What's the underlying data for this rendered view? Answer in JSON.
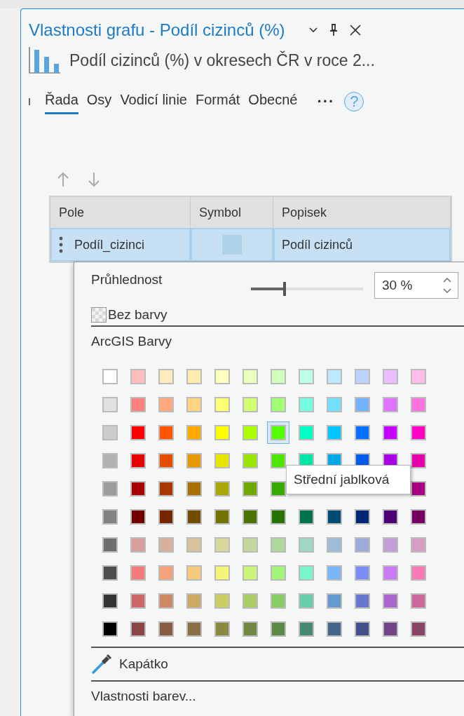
{
  "window": {
    "title": "Vlastnosti grafu - Podíl cizinců (%)"
  },
  "chart_title": "Podíl cizinců (%) v okresech ČR v roce 2...",
  "tabs": [
    {
      "label": "Řada",
      "selected": true
    },
    {
      "label": "Osy",
      "selected": false
    },
    {
      "label": "Vodicí linie",
      "selected": false
    },
    {
      "label": "Formát",
      "selected": false
    },
    {
      "label": "Obecné",
      "selected": false
    }
  ],
  "more": "···",
  "help": "?",
  "table": {
    "columns": [
      "Pole",
      "Symbol",
      "Popisek"
    ],
    "rows": [
      {
        "field": "Podíl_cizinci",
        "label": "Podíl cizinců",
        "selected": true
      }
    ]
  },
  "popup": {
    "transparency_label": "Průhlednost",
    "transparency": {
      "level": 0.3,
      "value": "30 %"
    },
    "no_color": "Bez barvy",
    "palette_title": "ArcGIS Barvy",
    "swatches": [
      [
        {
          "color": "#ffffff",
          "selected": false
        },
        {
          "color": "#ffbebe",
          "selected": false
        },
        {
          "color": "#ffebbe",
          "selected": false
        },
        {
          "color": "#ffebaf",
          "selected": false
        },
        {
          "color": "#ffffbe",
          "selected": false
        },
        {
          "color": "#e9ffbe",
          "selected": false
        },
        {
          "color": "#d3ffbe",
          "selected": false
        },
        {
          "color": "#beffe8",
          "selected": false
        },
        {
          "color": "#bee8ff",
          "selected": false
        },
        {
          "color": "#bed2ff",
          "selected": false
        },
        {
          "color": "#e8beff",
          "selected": false
        },
        {
          "color": "#ffbee8",
          "selected": false
        }
      ],
      [
        {
          "color": "#e1e1e1",
          "selected": false
        },
        {
          "color": "#ff7f7f",
          "selected": false
        },
        {
          "color": "#ffa77f",
          "selected": false
        },
        {
          "color": "#ffd37f",
          "selected": false
        },
        {
          "color": "#ffff73",
          "selected": false
        },
        {
          "color": "#d1ff73",
          "selected": false
        },
        {
          "color": "#a3ff73",
          "selected": false
        },
        {
          "color": "#73ffdf",
          "selected": false
        },
        {
          "color": "#73dfff",
          "selected": false
        },
        {
          "color": "#73b2ff",
          "selected": false
        },
        {
          "color": "#df73ff",
          "selected": false
        },
        {
          "color": "#ff73df",
          "selected": false
        }
      ],
      [
        {
          "color": "#cccccc",
          "selected": false
        },
        {
          "color": "#ff0000",
          "selected": false
        },
        {
          "color": "#ff5500",
          "selected": false
        },
        {
          "color": "#ffaa00",
          "selected": false
        },
        {
          "color": "#ffff00",
          "selected": false
        },
        {
          "color": "#aaff00",
          "selected": false
        },
        {
          "color": "#55ff00",
          "selected": true
        },
        {
          "color": "#00ffc5",
          "selected": false
        },
        {
          "color": "#00c5ff",
          "selected": false
        },
        {
          "color": "#0070ff",
          "selected": false
        },
        {
          "color": "#c500ff",
          "selected": false
        },
        {
          "color": "#ff00c5",
          "selected": false
        }
      ],
      [
        {
          "color": "#b2b2b2",
          "selected": false
        },
        {
          "color": "#e60000",
          "selected": false
        },
        {
          "color": "#e64c00",
          "selected": false
        },
        {
          "color": "#e69800",
          "selected": false
        },
        {
          "color": "#e6e600",
          "selected": false
        },
        {
          "color": "#98e600",
          "selected": false
        },
        {
          "color": "#4ce600",
          "selected": false
        },
        {
          "color": "#00e6a9",
          "selected": false
        },
        {
          "color": "#00a9e6",
          "selected": false
        },
        {
          "color": "#005ce6",
          "selected": false
        },
        {
          "color": "#a900e6",
          "selected": false
        },
        {
          "color": "#e600a9",
          "selected": false
        }
      ],
      [
        {
          "color": "#9c9c9c",
          "selected": false
        },
        {
          "color": "#a80000",
          "selected": false
        },
        {
          "color": "#a83800",
          "selected": false
        },
        {
          "color": "#a87000",
          "selected": false
        },
        {
          "color": "#a8a800",
          "selected": false
        },
        {
          "color": "#70a800",
          "selected": false
        },
        {
          "color": "#38a800",
          "selected": false
        },
        {
          "color": "#a80084",
          "selected": false
        }
      ],
      [
        {
          "color": "#828282",
          "selected": false
        },
        {
          "color": "#730000",
          "selected": false
        },
        {
          "color": "#732600",
          "selected": false
        },
        {
          "color": "#734c00",
          "selected": false
        },
        {
          "color": "#737300",
          "selected": false
        },
        {
          "color": "#4c7300",
          "selected": false
        },
        {
          "color": "#267300",
          "selected": false
        },
        {
          "color": "#00734c",
          "selected": false
        },
        {
          "color": "#004c73",
          "selected": false
        },
        {
          "color": "#002673",
          "selected": false
        },
        {
          "color": "#4c0073",
          "selected": false
        },
        {
          "color": "#730060",
          "selected": false
        }
      ],
      [
        {
          "color": "#6e6e6e",
          "selected": false
        },
        {
          "color": "#d79e9e",
          "selected": false
        },
        {
          "color": "#d7b09e",
          "selected": false
        },
        {
          "color": "#d7c29e",
          "selected": false
        },
        {
          "color": "#d7d79e",
          "selected": false
        },
        {
          "color": "#c2d69e",
          "selected": false
        },
        {
          "color": "#b0d79e",
          "selected": false
        },
        {
          "color": "#9ed7c2",
          "selected": false
        },
        {
          "color": "#9ebbd7",
          "selected": false
        },
        {
          "color": "#9eaad7",
          "selected": false
        },
        {
          "color": "#c29ed7",
          "selected": false
        },
        {
          "color": "#d69ec2",
          "selected": false
        }
      ],
      [
        {
          "color": "#4e4e4e",
          "selected": false
        },
        {
          "color": "#f57a7a",
          "selected": false
        },
        {
          "color": "#f5a27a",
          "selected": false
        },
        {
          "color": "#f5ca7a",
          "selected": false
        },
        {
          "color": "#f5f57a",
          "selected": false
        },
        {
          "color": "#cdf57a",
          "selected": false
        },
        {
          "color": "#a5f57a",
          "selected": false
        },
        {
          "color": "#7af5ca",
          "selected": false
        },
        {
          "color": "#7ab6f5",
          "selected": false
        },
        {
          "color": "#7a8ef5",
          "selected": false
        },
        {
          "color": "#ca7af5",
          "selected": false
        },
        {
          "color": "#f57ab6",
          "selected": false
        }
      ],
      [
        {
          "color": "#343434",
          "selected": false
        },
        {
          "color": "#cd6666",
          "selected": false
        },
        {
          "color": "#cd8966",
          "selected": false
        },
        {
          "color": "#cdaa66",
          "selected": false
        },
        {
          "color": "#cdcd66",
          "selected": false
        },
        {
          "color": "#aacd66",
          "selected": false
        },
        {
          "color": "#89cd66",
          "selected": false
        },
        {
          "color": "#66cdab",
          "selected": false
        },
        {
          "color": "#6699cd",
          "selected": false
        },
        {
          "color": "#6677cd",
          "selected": false
        },
        {
          "color": "#aa66cd",
          "selected": false
        },
        {
          "color": "#cd6699",
          "selected": false
        }
      ],
      [
        {
          "color": "#000000",
          "selected": false
        },
        {
          "color": "#894444",
          "selected": false
        },
        {
          "color": "#895a44",
          "selected": false
        },
        {
          "color": "#897044",
          "selected": false
        },
        {
          "color": "#898944",
          "selected": false
        },
        {
          "color": "#708944",
          "selected": false
        },
        {
          "color": "#5c8944",
          "selected": false
        },
        {
          "color": "#448970",
          "selected": false
        },
        {
          "color": "#446589",
          "selected": false
        },
        {
          "color": "#444f89",
          "selected": false
        },
        {
          "color": "#704489",
          "selected": false
        },
        {
          "color": "#894465",
          "selected": false
        }
      ]
    ],
    "tooltip": "Střední jablková",
    "eyedropper": "Kapátko",
    "color_properties": "Vlastnosti barev..."
  }
}
